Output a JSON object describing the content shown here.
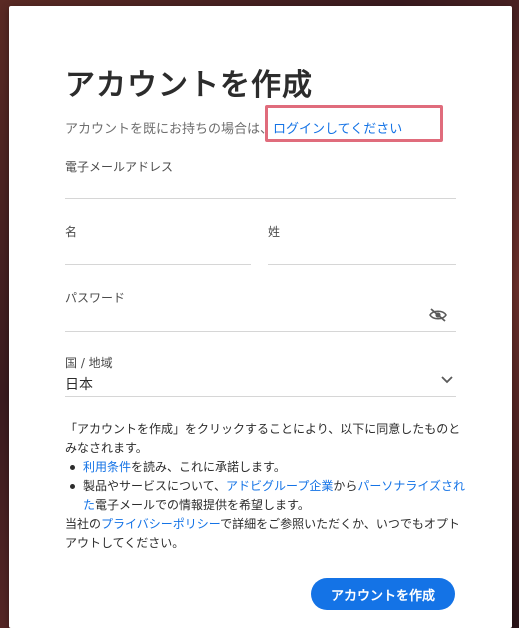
{
  "title": "アカウントを作成",
  "login_prompt": {
    "prefix": "アカウントを既にお持ちの場合は、",
    "link": "ログインしてください"
  },
  "fields": {
    "email": {
      "label": "電子メールアドレス",
      "value": ""
    },
    "first_name": {
      "label": "名",
      "value": ""
    },
    "last_name": {
      "label": "姓",
      "value": ""
    },
    "password": {
      "label": "パスワード",
      "value": ""
    },
    "country": {
      "label": "国 / 地域",
      "value": "日本"
    }
  },
  "legal": {
    "intro": "「アカウントを作成」をクリックすることにより、以下に同意したものとみなされます。",
    "bullet1_link": "利用条件",
    "bullet1_text": "を読み、これに承諾します。",
    "bullet2_pre": "製品やサービスについて、",
    "bullet2_link1": "アドビグループ企業",
    "bullet2_mid": "から",
    "bullet2_link2": "パーソナライズされた",
    "bullet2_post": "電子メールでの情報提供を希望します。",
    "privacy_pre": "当社の",
    "privacy_link": "プライバシーポリシー",
    "privacy_post": "で詳細をご参照いただくか、いつでもオプトアウトしてください。"
  },
  "create_button": "アカウントを作成",
  "icons": {
    "password_toggle": "eye-slash-icon",
    "country_dropdown": "chevron-down-icon"
  },
  "colors": {
    "accent": "#1473e6",
    "highlight": "#e06c7c"
  }
}
